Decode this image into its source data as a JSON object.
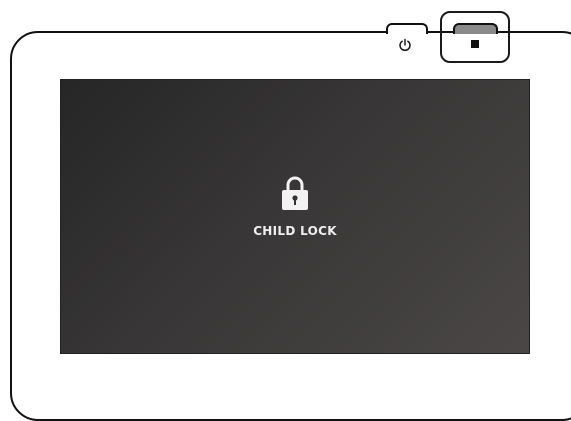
{
  "device": {
    "power_key_icon": "power-icon",
    "stop_key_icon": "stop-icon",
    "highlight_color": "#1a1a1a"
  },
  "screen": {
    "icon": "lock-icon",
    "label": "CHILD LOCK",
    "background_color": "#333131",
    "text_color": "#f0f0f0"
  }
}
